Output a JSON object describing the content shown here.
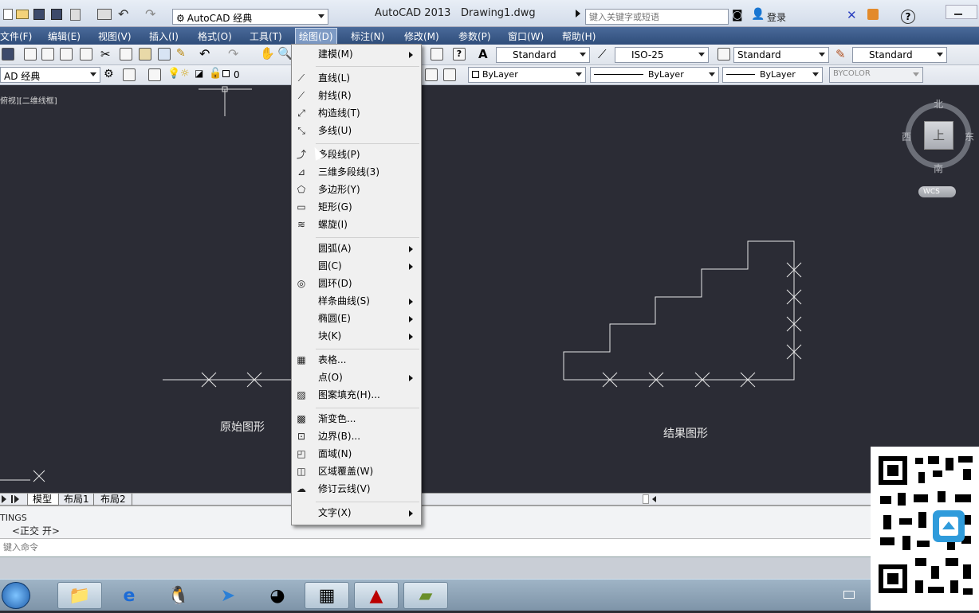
{
  "window": {
    "app_title": "AutoCAD 2013",
    "document_title": "Drawing1.dwg",
    "workspace": "AutoCAD 经典",
    "search_placeholder": "键入关键字或短语",
    "login_label": "登录",
    "help_label": "?"
  },
  "menubar": [
    "文件(F)",
    "编辑(E)",
    "视图(V)",
    "插入(I)",
    "格式(O)",
    "工具(T)",
    "绘图(D)",
    "标注(N)",
    "修改(M)",
    "参数(P)",
    "窗口(W)",
    "帮助(H)"
  ],
  "menubar_active": "绘图(D)",
  "toolbar": {
    "text_style": "Standard",
    "dim_style": "ISO-25",
    "table_style": "Standard",
    "mleader_style": "Standard",
    "workspace_combo": "AD 经典",
    "layer_value": "0",
    "color": "ByLayer",
    "linetype": "ByLayer",
    "lineweight": "ByLayer",
    "plot_style": "BYCOLOR"
  },
  "viewport_label": "俯视][二维线框]",
  "viewcube": {
    "north": "北",
    "south": "南",
    "east": "东",
    "west": "西",
    "face": "上",
    "ucs": "WCS"
  },
  "drawing": {
    "original_caption": "原始图形",
    "result_caption": "结果图形"
  },
  "draw_menu": [
    {
      "label": "建模(M)",
      "icon": "",
      "submenu": true
    },
    {
      "label": "直线(L)",
      "icon": "line-icon",
      "submenu": false
    },
    {
      "label": "射线(R)",
      "icon": "ray-icon",
      "submenu": false
    },
    {
      "label": "构造线(T)",
      "icon": "construction-line-icon",
      "submenu": false
    },
    {
      "label": "多线(U)",
      "icon": "multiline-icon",
      "submenu": false
    },
    {
      "label": "多段线(P)",
      "icon": "polyline-icon",
      "submenu": false
    },
    {
      "label": "三维多段线(3)",
      "icon": "3d-polyline-icon",
      "submenu": false
    },
    {
      "label": "多边形(Y)",
      "icon": "polygon-icon",
      "submenu": false
    },
    {
      "label": "矩形(G)",
      "icon": "rectangle-icon",
      "submenu": false
    },
    {
      "label": "螺旋(I)",
      "icon": "helix-icon",
      "submenu": false
    },
    {
      "label": "圆弧(A)",
      "icon": "",
      "submenu": true
    },
    {
      "label": "圆(C)",
      "icon": "",
      "submenu": true
    },
    {
      "label": "圆环(D)",
      "icon": "donut-icon",
      "submenu": false
    },
    {
      "label": "样条曲线(S)",
      "icon": "",
      "submenu": true
    },
    {
      "label": "椭圆(E)",
      "icon": "",
      "submenu": true
    },
    {
      "label": "块(K)",
      "icon": "",
      "submenu": true
    },
    {
      "label": "表格...",
      "icon": "table-icon",
      "submenu": false
    },
    {
      "label": "点(O)",
      "icon": "",
      "submenu": true
    },
    {
      "label": "图案填充(H)...",
      "icon": "hatch-icon",
      "submenu": false
    },
    {
      "label": "渐变色...",
      "icon": "gradient-icon",
      "submenu": false
    },
    {
      "label": "边界(B)...",
      "icon": "boundary-icon",
      "submenu": false
    },
    {
      "label": "面域(N)",
      "icon": "region-icon",
      "submenu": false
    },
    {
      "label": "区域覆盖(W)",
      "icon": "wipeout-icon",
      "submenu": false
    },
    {
      "label": "修订云线(V)",
      "icon": "revcloud-icon",
      "submenu": false
    },
    {
      "label": "文字(X)",
      "icon": "",
      "submenu": true
    }
  ],
  "layout_tabs": [
    "模型",
    "布局1",
    "布局2"
  ],
  "command": {
    "history_line1": "TINGS",
    "history_line2": "<正交 开>",
    "prompt": "键入命令"
  }
}
